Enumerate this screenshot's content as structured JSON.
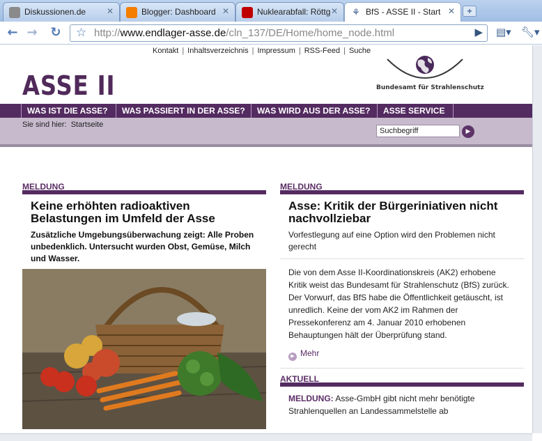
{
  "browser": {
    "tabs": [
      {
        "title": "Diskussionen.de",
        "icon": "feather-icon",
        "color": "#5a5a5a"
      },
      {
        "title": "Blogger: Dashboard",
        "icon": "blogger-icon",
        "color": "#f57d00"
      },
      {
        "title": "Nuklearabfall: Röttg",
        "icon": "spon-icon",
        "color": "#c00000"
      },
      {
        "title": "BfS - ASSE II - Start",
        "icon": "bfs-icon",
        "color": "#3a5a8a"
      }
    ],
    "url_prefix": "http://",
    "url_host": "www.endlager-asse.de",
    "url_path": "/cln_137/DE/Home/home_node.html"
  },
  "site": {
    "meta_nav": [
      "Kontakt",
      "Inhaltsverzeichnis",
      "Impressum",
      "RSS-Feed",
      "Suche"
    ],
    "logo": "ASSE II",
    "agency": "Bundesamt für Strahlenschutz",
    "main_nav": [
      "WAS IST DIE ASSE?",
      "WAS PASSIERT IN DER ASSE?",
      "WAS WIRD AUS DER ASSE?",
      "ASSE SERVICE"
    ],
    "breadcrumb_label": "Sie sind hier:",
    "breadcrumb_page": "Startseite",
    "search_value": "Suchbegriff"
  },
  "left": {
    "section": "MELDUNG",
    "headline": "Keine erhöhten radioaktiven Belastungen im Umfeld der Asse",
    "teaser": "Zusätzliche Umgebungsüberwachung zeigt: Alle Proben unbedenklich. Untersucht wurden Obst, Gemüse, Milch und Wasser."
  },
  "right": {
    "section": "MELDUNG",
    "headline": "Asse: Kritik der Bürgeriniativen nicht nachvollziebar",
    "teaser": "Vorfestlegung auf eine Option wird den Problemen nicht gerecht",
    "body": "Die von dem Asse II-Koordinationskreis (AK2) erhobene Kritik weist das Bundesamt für Strahlenschutz (BfS) zurück. Der Vorwurf, das BfS habe die Öffentlichkeit getäuscht, ist unredlich. Keine der vom AK2 im Rahmen der Pressekonferenz am 4. Januar 2010 erhobenen Behauptungen hält der Überprüfung stand.",
    "more": "Mehr",
    "aktuell_section": "AKTUELL",
    "aktuell_label": "MELDUNG:",
    "aktuell_text": "Asse-GmbH gibt nicht mehr benötigte Strahlenquellen an Landessammelstelle ab"
  },
  "colors": {
    "brand": "#532b60",
    "nav_bg": "#532b60",
    "crumb_bg": "#c7bacd"
  }
}
